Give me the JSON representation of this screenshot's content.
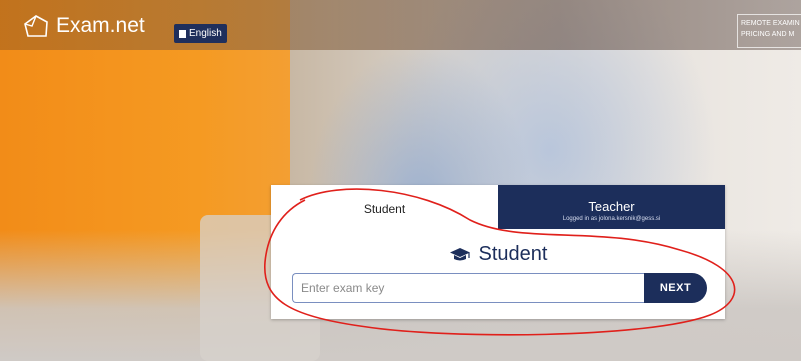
{
  "header": {
    "logo_text": "Exam.net",
    "language_button": "English",
    "top_links": [
      "REMOTE EXAMIN",
      "PRICING AND M"
    ]
  },
  "login": {
    "tab_student": "Student",
    "tab_teacher": "Teacher",
    "teacher_sub": "Logged in as jolona.kersnik@gess.si",
    "heading": "Student",
    "input_placeholder": "Enter exam key",
    "next_button": "NEXT"
  },
  "colors": {
    "brand_navy": "#1c2e5b",
    "orange": "#f28c18",
    "annotation_red": "#e0201b"
  },
  "icons": [
    "exam-net-logo-icon",
    "flag-icon",
    "graduation-cap-icon"
  ]
}
